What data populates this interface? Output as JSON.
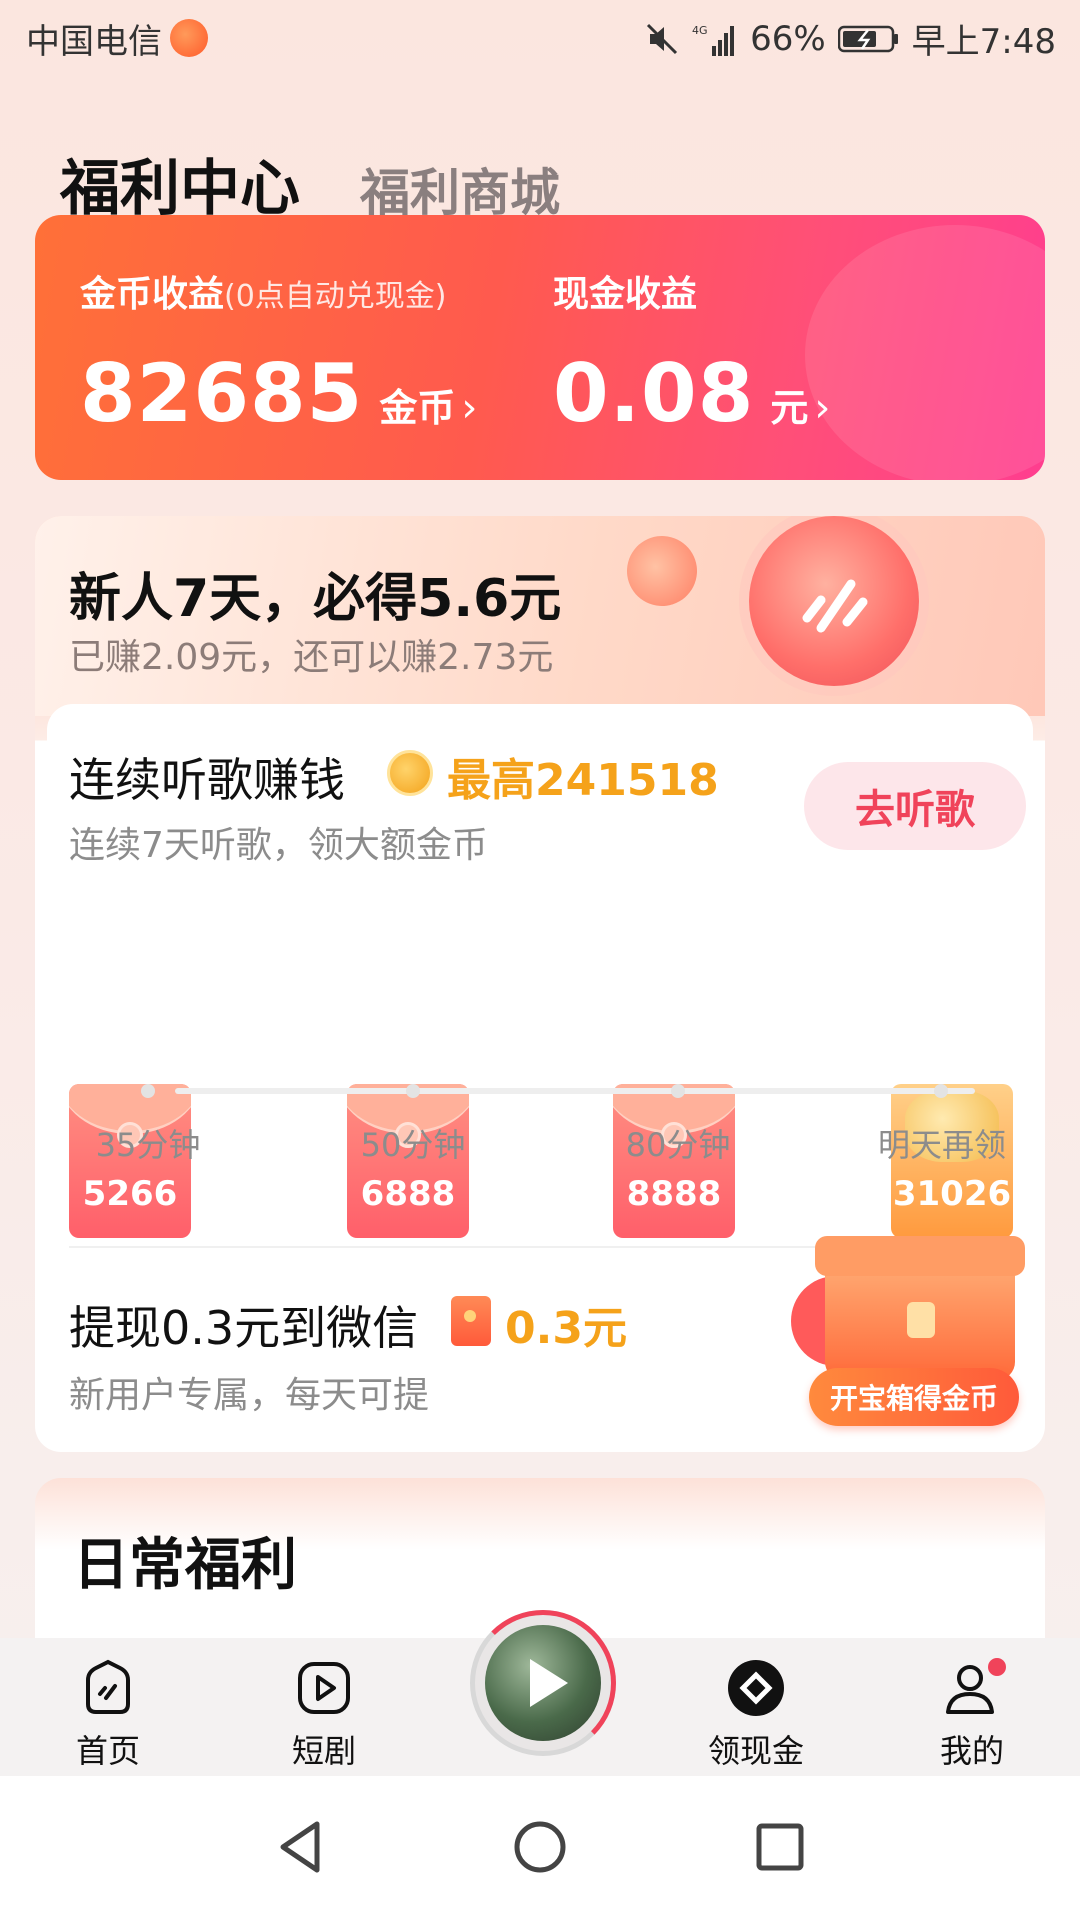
{
  "status_bar": {
    "carrier": "中国电信",
    "battery": "66%",
    "time": "早上7:48",
    "icons": [
      "app-badge-icon",
      "mute-icon",
      "signal-icon",
      "battery-icon"
    ]
  },
  "tabs": [
    {
      "label": "福利中心",
      "active": true
    },
    {
      "label": "福利商城",
      "active": false
    }
  ],
  "earnings": {
    "coin": {
      "title": "金币收益",
      "note": "(0点自动兑现金)",
      "value": "82685",
      "unit": "金币"
    },
    "cash": {
      "title": "现金收益",
      "value": "0.08",
      "unit": "元"
    },
    "chevron": "›"
  },
  "newbie": {
    "title": "新人7天，必得5.6元",
    "subtitle": "已赚2.09元，还可以赚2.73元"
  },
  "listen_task": {
    "title": "连续听歌赚钱",
    "max_label": "最高241518",
    "subtitle": "连续7天听歌，领大额金币",
    "button": "去听歌",
    "rewards": [
      {
        "amount": "5266",
        "time": "35分钟",
        "type": "red"
      },
      {
        "amount": "6888",
        "time": "50分钟",
        "type": "red"
      },
      {
        "amount": "8888",
        "time": "80分钟",
        "type": "red"
      },
      {
        "amount": "31026",
        "time": "明天再领",
        "type": "gold"
      }
    ]
  },
  "withdraw_task": {
    "title": "提现0.3元到微信",
    "amount": "0.3元",
    "subtitle": "新用户专属，每天可提",
    "chest_button": "开宝箱得金币"
  },
  "daily": {
    "title": "日常福利"
  },
  "bottom_nav": [
    {
      "label": "首页",
      "icon": "home-icon"
    },
    {
      "label": "短剧",
      "icon": "play-video-icon"
    },
    {
      "label": "",
      "icon": "music-player-icon"
    },
    {
      "label": "领现金",
      "icon": "cash-icon"
    },
    {
      "label": "我的",
      "icon": "profile-icon"
    }
  ],
  "colors": {
    "accent_red": "#f0435a",
    "gold": "#f5a21a",
    "card_gradient_start": "#ff7038",
    "card_gradient_end": "#ff3d8f"
  }
}
